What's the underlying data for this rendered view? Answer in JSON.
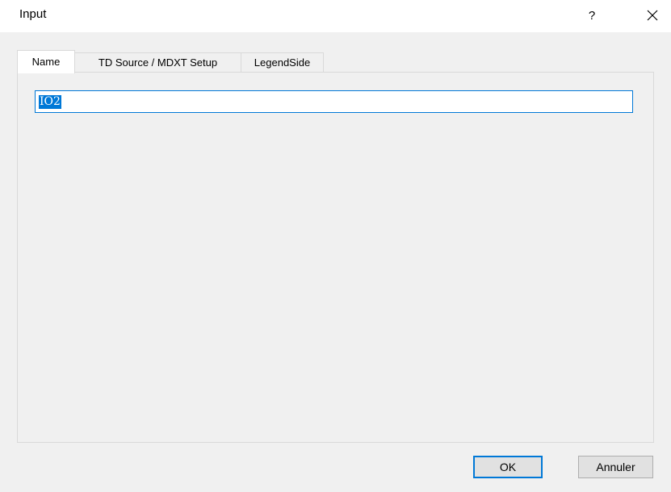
{
  "window": {
    "title": "Input",
    "help_label": "?",
    "close_icon": "close-icon"
  },
  "tabs": [
    {
      "label": "Name",
      "active": true
    },
    {
      "label": "TD Source / MDXT Setup",
      "active": false
    },
    {
      "label": "LegendSide",
      "active": false
    }
  ],
  "name_field": {
    "value": "IO2"
  },
  "buttons": {
    "ok_label": "OK",
    "cancel_label": "Annuler"
  },
  "colors": {
    "accent": "#0078d7",
    "background": "#f0f0f0",
    "border": "#d9d9d9"
  }
}
